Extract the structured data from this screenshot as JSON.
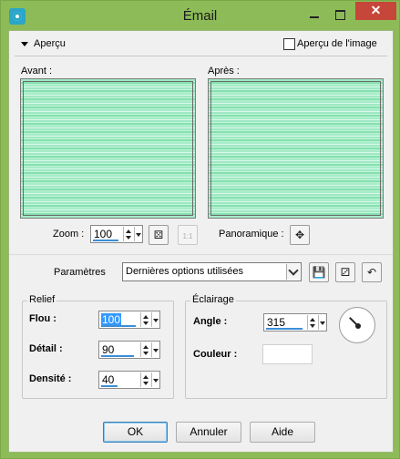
{
  "window": {
    "title": "Émail",
    "controls": {
      "minimize": "",
      "maximize": "",
      "close": "✕"
    }
  },
  "preview_section": {
    "toggle_label": "Aperçu",
    "image_preview_label": "Aperçu de l'image",
    "image_preview_checked": false,
    "before_label": "Avant :",
    "after_label": "Après :",
    "zoom_label": "Zoom :",
    "zoom_value": "100",
    "pan_label": "Panoramique :"
  },
  "presets": {
    "label": "Paramètres",
    "selected": "Dernières options utilisées"
  },
  "relief": {
    "title": "Relief",
    "blur_label": "Flou :",
    "blur_value": "100",
    "detail_label": "Détail :",
    "detail_value": "90",
    "density_label": "Densité :",
    "density_value": "40"
  },
  "lighting": {
    "title": "Éclairage",
    "angle_label": "Angle :",
    "angle_value": "315",
    "color_label": "Couleur :",
    "color_value": "#ffffff"
  },
  "buttons": {
    "ok": "OK",
    "cancel": "Annuler",
    "help": "Aide"
  },
  "icons": {
    "app": "paintshop-icon",
    "fit_zoom": "fit-zoom-icon",
    "actual_size": "one-to-one-icon",
    "pan": "move-crosshair-icon",
    "save_preset": "floppy-disk-icon",
    "randomize": "dice-icon",
    "reset": "reset-icon"
  }
}
